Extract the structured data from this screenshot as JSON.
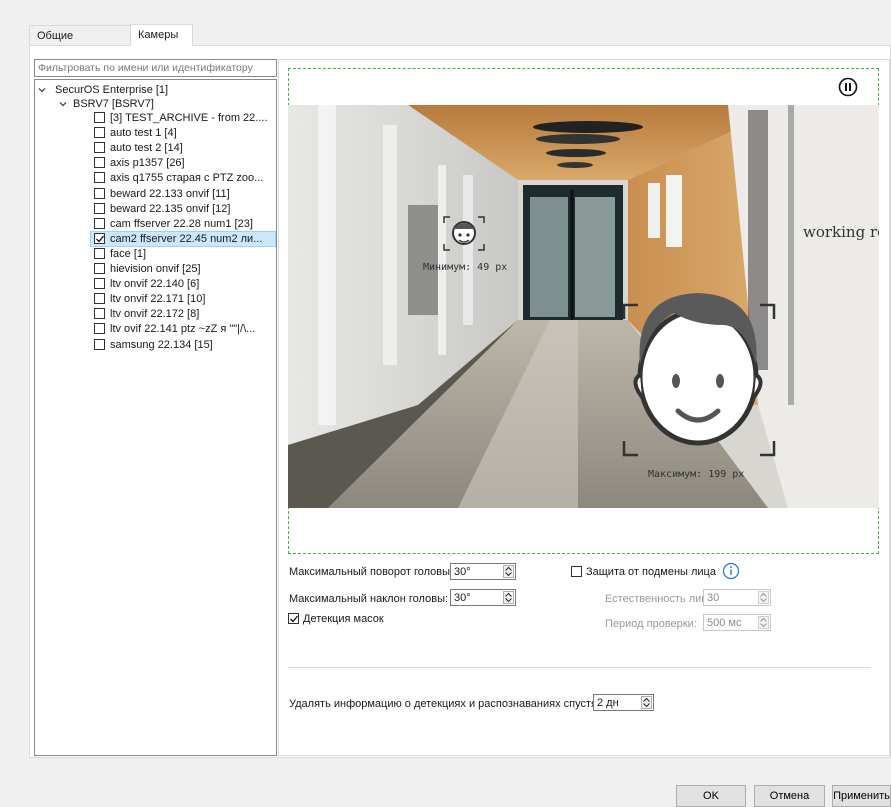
{
  "tabs": [
    {
      "label": "Общие настройки"
    },
    {
      "label": "Камеры"
    }
  ],
  "filter": {
    "placeholder": "Фильтровать по имени или идентификатору"
  },
  "tree": {
    "root": "SecurOS Enterprise [1]",
    "server": "BSRV7 [BSRV7]",
    "cameras": [
      {
        "label": "[3] TEST_ARCHIVE - from 22....",
        "checked": false
      },
      {
        "label": "auto test 1 [4]",
        "checked": false
      },
      {
        "label": "auto test 2 [14]",
        "checked": false
      },
      {
        "label": "axis p1357 [26]",
        "checked": false
      },
      {
        "label": "axis q1755 старая с PTZ zoo...",
        "checked": false
      },
      {
        "label": "beward 22.133 onvif [11]",
        "checked": false
      },
      {
        "label": "beward 22.135 onvif [12]",
        "checked": false
      },
      {
        "label": "cam ffserver 22.28 num1 [23]",
        "checked": false
      },
      {
        "label": "cam2 ffserver 22.45 num2 ли...",
        "checked": true
      },
      {
        "label": "face [1]",
        "checked": false
      },
      {
        "label": "hievision onvif [25]",
        "checked": false
      },
      {
        "label": "ltv onvif 22.140 [6]",
        "checked": false
      },
      {
        "label": "ltv onvif 22.171 [10]",
        "checked": false
      },
      {
        "label": "ltv onvif 22.172 [8]",
        "checked": false
      },
      {
        "label": "ltv ovif 22.141 ptz ~zZ я \"\"|/\\...",
        "checked": false
      },
      {
        "label": "samsung 22.134 [15]",
        "checked": false
      }
    ]
  },
  "video": {
    "min_label": "Минимум: 49 px",
    "max_label": "Максимум: 199 px",
    "wall_text": "working rooms"
  },
  "settings": {
    "head_rotation": {
      "label": "Максимальный поворот головы:",
      "value": "30°"
    },
    "head_tilt": {
      "label": "Максимальный наклон головы:",
      "value": "30°"
    },
    "mask_detection": {
      "label": "Детекция масок",
      "checked": true
    },
    "spoof_protection": {
      "label": "Защита от подмены лица",
      "checked": false
    },
    "face_naturalness": {
      "label": "Естественность лица:",
      "value": "30"
    },
    "check_period": {
      "label": "Период проверки:",
      "value": "500 мс"
    },
    "retention": {
      "label": "Удалять информацию о детекциях и распознаваниях спустя:",
      "value": "2 дн"
    }
  },
  "buttons": {
    "ok": "OK",
    "cancel": "Отмена",
    "apply": "Применить"
  },
  "colors": {
    "accent": "#1e78d7",
    "selection": "#cce8ff",
    "dashed": "#3bb54a"
  }
}
